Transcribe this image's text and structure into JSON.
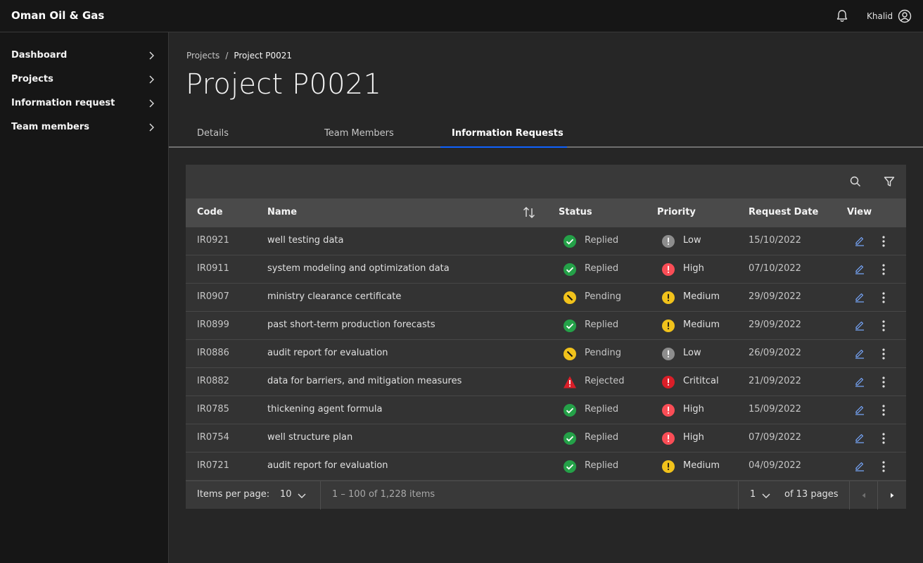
{
  "app": {
    "title": "Oman Oil & Gas"
  },
  "header": {
    "user_name": "Khalid",
    "icons": [
      "notification-icon",
      "user-avatar-icon"
    ]
  },
  "sidebar": {
    "items": [
      {
        "label": "Dashboard"
      },
      {
        "label": "Projects"
      },
      {
        "label": "Information request"
      },
      {
        "label": "Team members"
      }
    ]
  },
  "breadcrumb": {
    "parent": "Projects",
    "separator": "/",
    "current": "Project P0021"
  },
  "page": {
    "title": "Project P0021"
  },
  "tabs": [
    {
      "label": "Details",
      "active": false
    },
    {
      "label": "Team Members",
      "active": false
    },
    {
      "label": "Information Requests",
      "active": true
    }
  ],
  "table": {
    "columns": {
      "code": "Code",
      "name": "Name",
      "status": "Status",
      "priority": "Priority",
      "date": "Request Date",
      "view": "View"
    },
    "rows": [
      {
        "code": "IR0921",
        "name": "well testing data",
        "status": "Replied",
        "priority": "Low",
        "date": "15/10/2022"
      },
      {
        "code": "IR0911",
        "name": "system modeling and optimization data",
        "status": "Replied",
        "priority": "High",
        "date": "07/10/2022"
      },
      {
        "code": "IR0907",
        "name": "ministry clearance certificate",
        "status": "Pending",
        "priority": "Medium",
        "date": "29/09/2022"
      },
      {
        "code": "IR0899",
        "name": "past short-term production forecasts",
        "status": "Replied",
        "priority": "Medium",
        "date": "29/09/2022"
      },
      {
        "code": "IR0886",
        "name": "audit report for evaluation",
        "status": "Pending",
        "priority": "Low",
        "date": "26/09/2022"
      },
      {
        "code": "IR0882",
        "name": "data for barriers, and mitigation measures",
        "status": "Rejected",
        "priority": "Crititcal",
        "date": "21/09/2022"
      },
      {
        "code": "IR0785",
        "name": "thickening agent formula",
        "status": "Replied",
        "priority": "High",
        "date": "15/09/2022"
      },
      {
        "code": "IR0754",
        "name": "well structure plan",
        "status": "Replied",
        "priority": "High",
        "date": "07/09/2022"
      },
      {
        "code": "IR0721",
        "name": "audit report for evaluation",
        "status": "Replied",
        "priority": "Medium",
        "date": "04/09/2022"
      }
    ]
  },
  "pagination": {
    "items_per_page_label": "Items per page:",
    "items_per_page_value": "10",
    "range_text": "1 – 100 of 1,228 items",
    "page_value": "1",
    "pages_text": "of 13 pages"
  },
  "colors": {
    "replied": "#24a148",
    "pending": "#f1c21b",
    "rejected": "#da1e28",
    "priority_low": "#8d8d8d",
    "priority_medium": "#f1c21b",
    "priority_high": "#fa4d56",
    "priority_critical": "#da1e28",
    "tab_active": "#0f62fe",
    "edit_link": "#78a9ff"
  }
}
